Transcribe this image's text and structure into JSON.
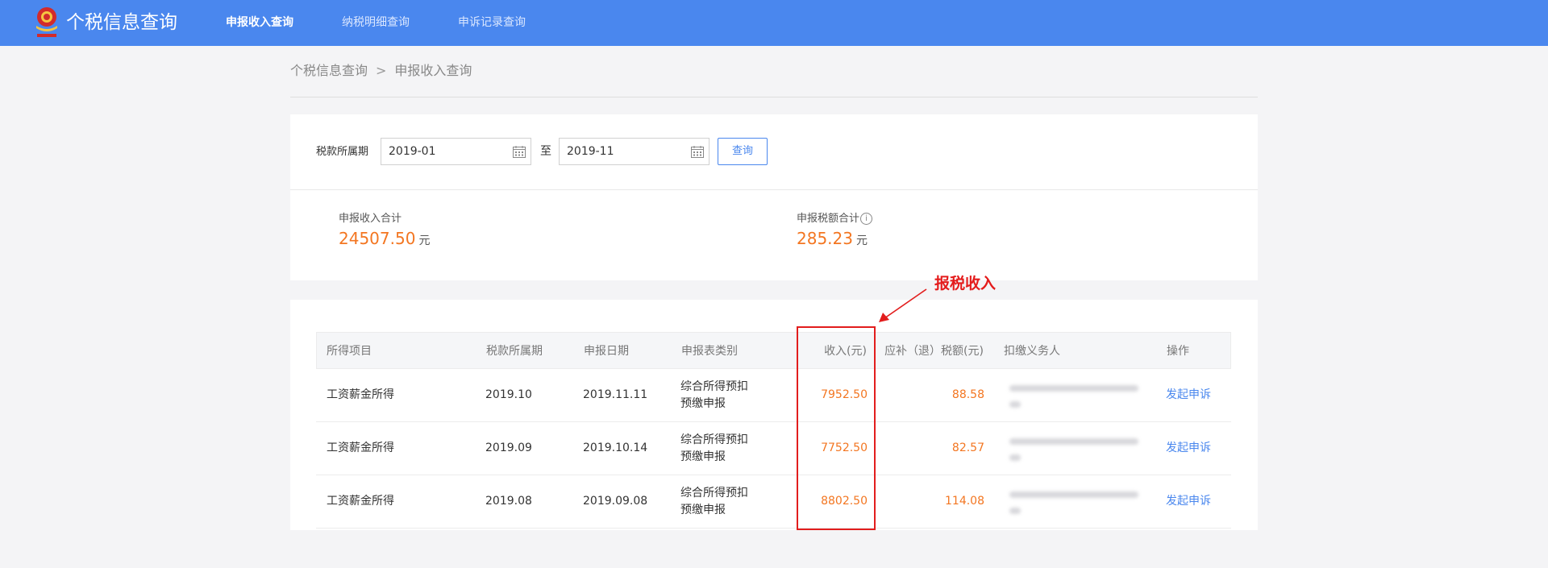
{
  "header": {
    "title": "个税信息查询",
    "nav": [
      {
        "label": "申报收入查询",
        "active": true
      },
      {
        "label": "纳税明细查询",
        "active": false
      },
      {
        "label": "申诉记录查询",
        "active": false
      }
    ],
    "logo_icon": "tax-emblem-icon",
    "bar_color": "#4a87ee"
  },
  "breadcrumb": {
    "root": "个税信息查询",
    "separator": ">",
    "current": "申报收入查询"
  },
  "filter": {
    "label": "税款所属期",
    "start": "2019-01",
    "to": "至",
    "end": "2019-11",
    "query_button": "查询"
  },
  "summary": {
    "income_label": "申报收入合计",
    "income_value": "24507.50",
    "tax_label": "申报税额合计",
    "tax_value": "285.23",
    "unit": "元",
    "info_icon": "i",
    "value_color": "#f37621"
  },
  "table": {
    "headers": [
      "所得项目",
      "税款所属期",
      "申报日期",
      "申报表类别",
      "收入(元)",
      "应补（退）税额(元)",
      "扣缴义务人",
      "操作"
    ],
    "rows": [
      {
        "item": "工资薪金所得",
        "period": "2019.10",
        "date": "2019.11.11",
        "type_line1": "综合所得预扣",
        "type_line2": "预缴申报",
        "income": "7952.50",
        "tax": "88.58",
        "action": "发起申诉"
      },
      {
        "item": "工资薪金所得",
        "period": "2019.09",
        "date": "2019.10.14",
        "type_line1": "综合所得预扣",
        "type_line2": "预缴申报",
        "income": "7752.50",
        "tax": "82.57",
        "action": "发起申诉"
      },
      {
        "item": "工资薪金所得",
        "period": "2019.08",
        "date": "2019.09.08",
        "type_line1": "综合所得预扣",
        "type_line2": "预缴申报",
        "income": "8802.50",
        "tax": "114.08",
        "action": "发起申诉"
      }
    ]
  },
  "annotation": {
    "text": "报税收入",
    "color": "#e21d1d"
  }
}
